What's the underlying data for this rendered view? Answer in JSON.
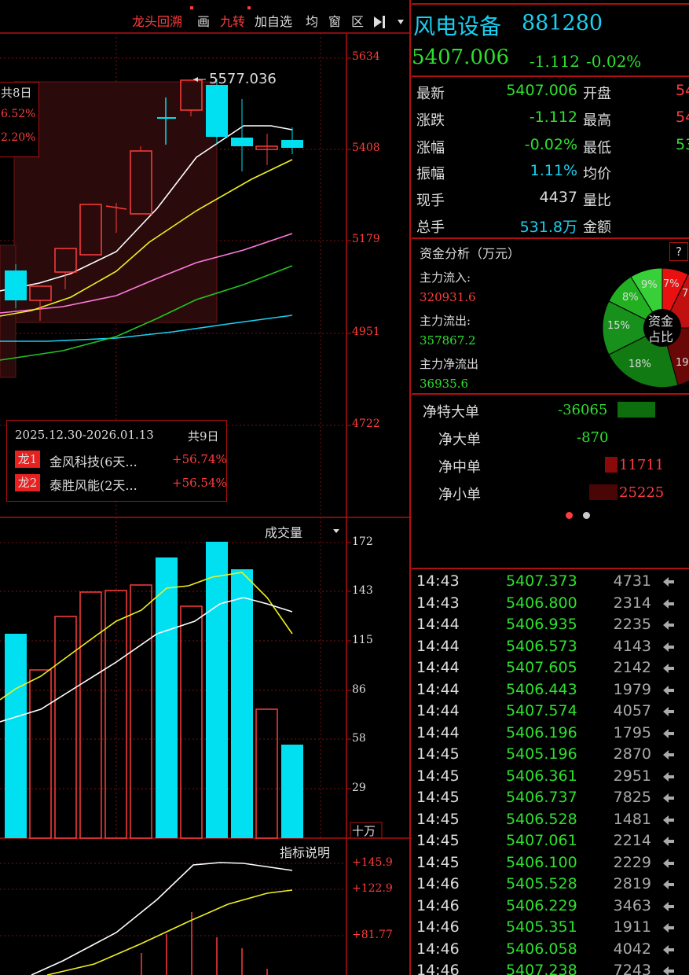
{
  "toolbar": {
    "dragon_review": "龙头回溯",
    "draw": "画",
    "nine_turn": "九转",
    "add_watchlist": "加自选",
    "average": "均",
    "window": "窗",
    "zone": "区"
  },
  "kline": {
    "price_axis": [
      "5634",
      "5408",
      "5179",
      "4951",
      "4722"
    ],
    "high_marker": "5577.036",
    "box_top": {
      "count": "共8日",
      "pct1": "6.52%",
      "pct2": "2.20%"
    },
    "dragon_box": {
      "range": "2025.12.30-2026.01.13",
      "count": "共9日",
      "items": [
        {
          "tag": "龙1",
          "name": "金风科技(6天...",
          "pct": "+56.74%"
        },
        {
          "tag": "龙2",
          "name": "泰胜风能(2天...",
          "pct": "+56.54%"
        }
      ]
    }
  },
  "volume": {
    "title": "成交量",
    "axis": [
      "172",
      "143",
      "115",
      "86",
      "58",
      "29"
    ],
    "unit": "十万"
  },
  "indicator": {
    "title": "指标说明",
    "axis": [
      "+145.9",
      "+122.9",
      "+81.77"
    ]
  },
  "stock": {
    "name": "风电设备",
    "code": "881280",
    "price": "5407.006",
    "change": "-1.112",
    "change_pct": "-0.02%"
  },
  "quote": {
    "latest_label": "最新",
    "latest": "5407.006",
    "open_label": "开盘",
    "open": "54",
    "change_label": "涨跌",
    "change": "-1.112",
    "high_label": "最高",
    "high": "54",
    "pct_label": "涨幅",
    "pct": "-0.02%",
    "low_label": "最低",
    "low": "53",
    "amp_label": "振幅",
    "amp": "1.11%",
    "avg_label": "均价",
    "hand_label": "现手",
    "hand": "4437",
    "ratio_label": "量比",
    "total_label": "总手",
    "total": "531.8万",
    "amount_label": "金额"
  },
  "fund": {
    "title": "资金分析（万元）",
    "help": "?",
    "inflow_label": "主力流入:",
    "inflow": "320931.6",
    "outflow_label": "主力流出:",
    "outflow": "357867.2",
    "net_label": "主力净流出",
    "net": "36935.6",
    "pie_center": [
      "资金",
      "占比"
    ],
    "pie_labels": [
      "7%",
      "7",
      "9%",
      "8%",
      "15%",
      "18%",
      "19"
    ]
  },
  "orders": [
    {
      "label": "净特大单",
      "value": "-36065"
    },
    {
      "label": "净大单",
      "value": "-870"
    },
    {
      "label": "净中单",
      "value": "11711"
    },
    {
      "label": "净小单",
      "value": "25225"
    }
  ],
  "ticks": [
    {
      "time": "14:43",
      "price": "5407.373",
      "vol": "4731"
    },
    {
      "time": "14:43",
      "price": "5406.800",
      "vol": "2314"
    },
    {
      "time": "14:44",
      "price": "5406.935",
      "vol": "2235"
    },
    {
      "time": "14:44",
      "price": "5406.573",
      "vol": "4143"
    },
    {
      "time": "14:44",
      "price": "5407.605",
      "vol": "2142"
    },
    {
      "time": "14:44",
      "price": "5406.443",
      "vol": "1979"
    },
    {
      "time": "14:44",
      "price": "5407.574",
      "vol": "4057"
    },
    {
      "time": "14:44",
      "price": "5406.196",
      "vol": "1795"
    },
    {
      "time": "14:45",
      "price": "5405.196",
      "vol": "2870"
    },
    {
      "time": "14:45",
      "price": "5406.361",
      "vol": "2951"
    },
    {
      "time": "14:45",
      "price": "5406.737",
      "vol": "7825"
    },
    {
      "time": "14:45",
      "price": "5406.528",
      "vol": "1481"
    },
    {
      "time": "14:45",
      "price": "5407.061",
      "vol": "2214"
    },
    {
      "time": "14:45",
      "price": "5406.100",
      "vol": "2229"
    },
    {
      "time": "14:46",
      "price": "5405.528",
      "vol": "2819"
    },
    {
      "time": "14:46",
      "price": "5406.229",
      "vol": "3463"
    },
    {
      "time": "14:46",
      "price": "5405.351",
      "vol": "1911"
    },
    {
      "time": "14:46",
      "price": "5406.058",
      "vol": "4042"
    },
    {
      "time": "14:46",
      "price": "5407.238",
      "vol": "7243"
    }
  ],
  "colors": {
    "up": "#ff3c3c",
    "down": "#00e0f0",
    "green": "#2ee02e",
    "grid": "#b01010"
  }
}
